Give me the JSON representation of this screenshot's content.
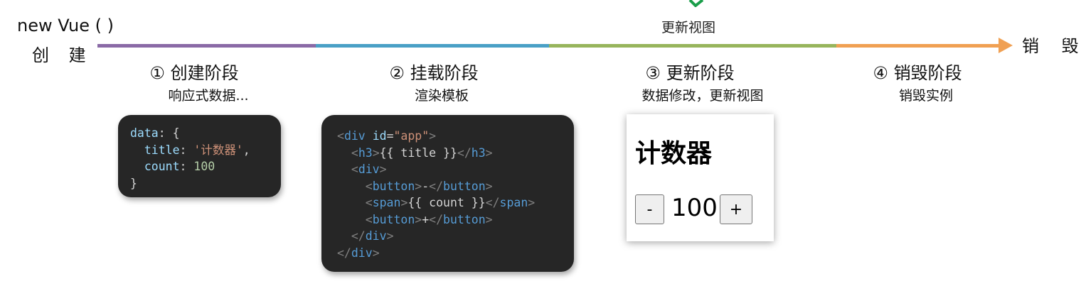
{
  "timeline": {
    "start_title": "new Vue ( )",
    "start_sub": "创 建",
    "end_label": "销 毁",
    "update_label": "更新视图",
    "colors": {
      "create": "#8a6aa6",
      "mount": "#4aa0c6",
      "update": "#97b55c",
      "destroy": "#f0a053"
    }
  },
  "stages": [
    {
      "title": "① 创建阶段",
      "sub": "响应式数据..."
    },
    {
      "title": "② 挂载阶段",
      "sub": "渲染模板"
    },
    {
      "title": "③ 更新阶段",
      "sub": "数据修改，更新视图"
    },
    {
      "title": "④ 销毁阶段",
      "sub": "销毁实例"
    }
  ],
  "data_code": {
    "key_data": "data",
    "colon": ":",
    "open_brace": " {",
    "key_title": "title",
    "title_value": "'计数器'",
    "comma": ",",
    "key_count": "count",
    "count_value": "100",
    "close_brace": "}"
  },
  "template_code": {
    "div_open_tag": "div",
    "id_attr": "id",
    "eq": "=",
    "id_value": "\"app\"",
    "h3_tag": "h3",
    "h3_text": "{{ title }}",
    "div_tag": "div",
    "button_tag": "button",
    "minus_text": "-",
    "span_tag": "span",
    "span_text": "{{ count }}",
    "plus_text": "+"
  },
  "rendered": {
    "title": "计数器",
    "minus": "-",
    "count": "100",
    "plus": "+"
  }
}
